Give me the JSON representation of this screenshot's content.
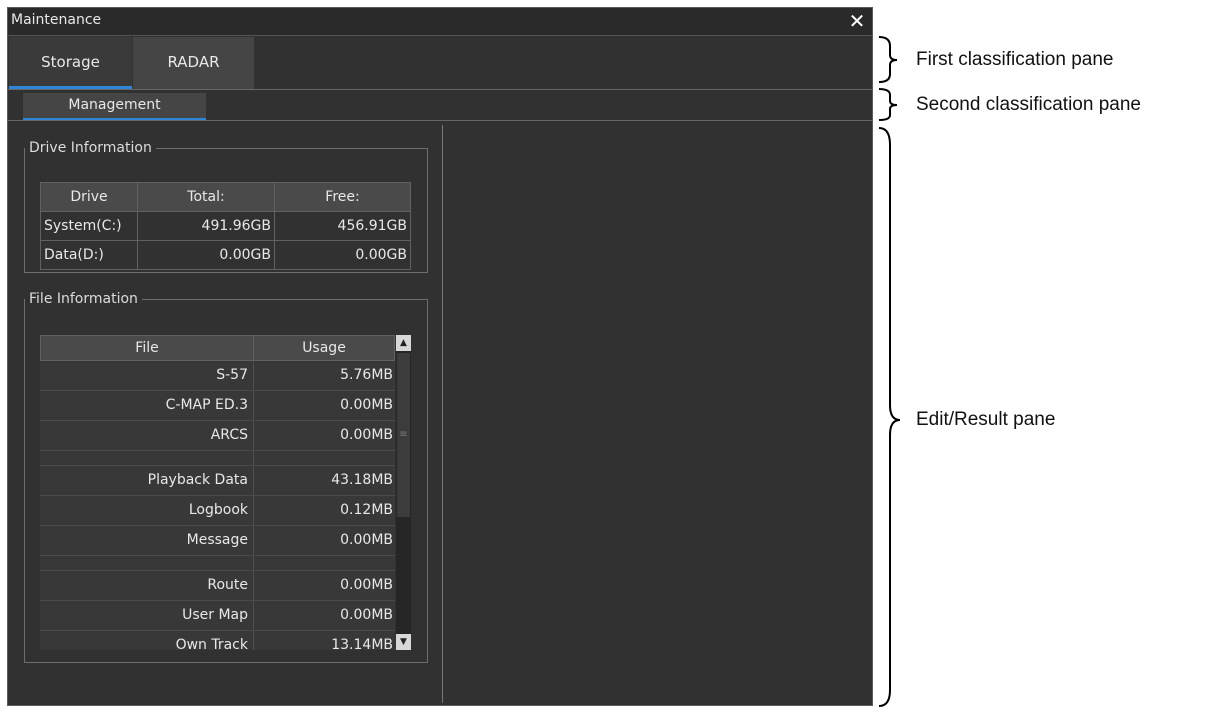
{
  "window": {
    "title": "Maintenance",
    "close_glyph": "✕"
  },
  "tabs": [
    {
      "label": "Storage",
      "selected": true
    },
    {
      "label": "RADAR",
      "selected": false
    }
  ],
  "subtabs": [
    {
      "label": "Management",
      "selected": true
    }
  ],
  "drive_info": {
    "title": "Drive Information",
    "columns": [
      "Drive",
      "Total:",
      "Free:"
    ],
    "rows": [
      [
        "System(C:)",
        "491.96GB",
        "456.91GB"
      ],
      [
        "Data(D:)",
        "0.00GB",
        "0.00GB"
      ]
    ]
  },
  "file_info": {
    "title": "File Information",
    "columns": [
      "File",
      "Usage"
    ],
    "rows": [
      [
        "S-57",
        "5.76MB"
      ],
      [
        "C-MAP ED.3",
        "0.00MB"
      ],
      [
        "ARCS",
        "0.00MB"
      ],
      [
        "",
        ""
      ],
      [
        "Playback Data",
        "43.18MB"
      ],
      [
        "Logbook",
        "0.12MB"
      ],
      [
        "Message",
        "0.00MB"
      ],
      [
        "",
        ""
      ],
      [
        "Route",
        "0.00MB"
      ],
      [
        "User Map",
        "0.00MB"
      ],
      [
        "Own Track",
        "13.14MB"
      ]
    ]
  },
  "annotations": {
    "first": "First classification pane",
    "second": "Second classification pane",
    "edit": "Edit/Result pane"
  },
  "colors": {
    "window_bg": "#313131",
    "accent_underline": "#2f86d8",
    "header_bg": "#4a4a4a"
  },
  "icons": {
    "close": "close-icon",
    "scroll_up": "arrow-up-icon",
    "scroll_down": "arrow-down-icon",
    "thumb_grip": "grip-icon"
  }
}
